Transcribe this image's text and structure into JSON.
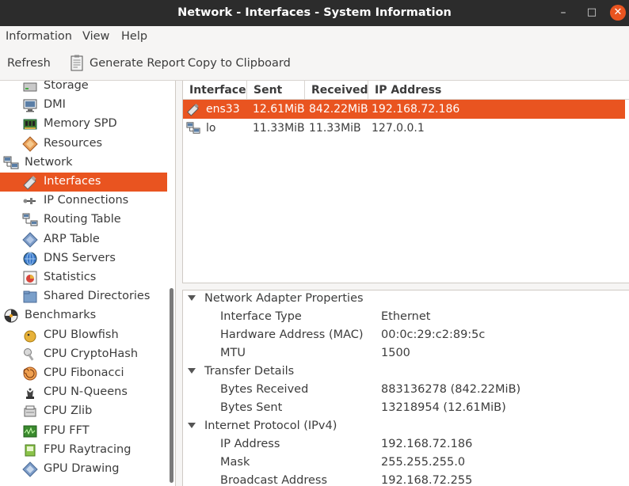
{
  "window": {
    "title": "Network - Interfaces - System Information",
    "minimize": "–",
    "maximize": "□",
    "close": "✕"
  },
  "menu": {
    "items": [
      "Information",
      "View",
      "Help"
    ]
  },
  "toolbar": {
    "refresh_label": "Refresh",
    "generate_report_label": "Generate Report",
    "copy_label": "Copy to Clipboard"
  },
  "sidebar": {
    "items": [
      {
        "label": "Storage",
        "icon": "storage-icon",
        "indent": 1
      },
      {
        "label": "DMI",
        "icon": "dmi-icon",
        "indent": 1
      },
      {
        "label": "Memory SPD",
        "icon": "memory-icon",
        "indent": 1
      },
      {
        "label": "Resources",
        "icon": "resources-icon",
        "indent": 1
      },
      {
        "label": "Network",
        "icon": "network-icon",
        "indent": 0
      },
      {
        "label": "Interfaces",
        "icon": "interface-icon",
        "indent": 1,
        "selected": true
      },
      {
        "label": "IP Connections",
        "icon": "ip-connections-icon",
        "indent": 1
      },
      {
        "label": "Routing Table",
        "icon": "routing-table-icon",
        "indent": 1
      },
      {
        "label": "ARP Table",
        "icon": "arp-table-icon",
        "indent": 1
      },
      {
        "label": "DNS Servers",
        "icon": "dns-servers-icon",
        "indent": 1
      },
      {
        "label": "Statistics",
        "icon": "statistics-icon",
        "indent": 1
      },
      {
        "label": "Shared Directories",
        "icon": "shared-directories-icon",
        "indent": 1
      },
      {
        "label": "Benchmarks",
        "icon": "benchmarks-icon",
        "indent": 0
      },
      {
        "label": "CPU Blowfish",
        "icon": "blowfish-icon",
        "indent": 1
      },
      {
        "label": "CPU CryptoHash",
        "icon": "cryptohash-icon",
        "indent": 1
      },
      {
        "label": "CPU Fibonacci",
        "icon": "fibonacci-icon",
        "indent": 1
      },
      {
        "label": "CPU N-Queens",
        "icon": "nqueens-icon",
        "indent": 1
      },
      {
        "label": "CPU Zlib",
        "icon": "zlib-icon",
        "indent": 1
      },
      {
        "label": "FPU FFT",
        "icon": "fft-icon",
        "indent": 1
      },
      {
        "label": "FPU Raytracing",
        "icon": "raytracing-icon",
        "indent": 1
      },
      {
        "label": "GPU Drawing",
        "icon": "gpu-drawing-icon",
        "indent": 1
      }
    ]
  },
  "table": {
    "columns": [
      "Interface",
      "Sent",
      "Received",
      "IP Address"
    ],
    "rows": [
      {
        "interface": "ens33",
        "sent": "12.61MiB",
        "received": "842.22MiB",
        "ip": "192.168.72.186",
        "selected": true
      },
      {
        "interface": "lo",
        "sent": "11.33MiB",
        "received": "11.33MiB",
        "ip": "127.0.0.1"
      }
    ]
  },
  "details": {
    "sections": [
      {
        "title": "Network Adapter Properties",
        "rows": [
          {
            "key": "Interface Type",
            "value": "Ethernet"
          },
          {
            "key": "Hardware Address (MAC)",
            "value": "00:0c:29:c2:89:5c"
          },
          {
            "key": "MTU",
            "value": "1500"
          }
        ]
      },
      {
        "title": "Transfer Details",
        "rows": [
          {
            "key": "Bytes Received",
            "value": "883136278 (842.22MiB)"
          },
          {
            "key": "Bytes Sent",
            "value": "13218954 (12.61MiB)"
          }
        ]
      },
      {
        "title": "Internet Protocol (IPv4)",
        "rows": [
          {
            "key": "IP Address",
            "value": "192.168.72.186"
          },
          {
            "key": "Mask",
            "value": "255.255.255.0"
          },
          {
            "key": "Broadcast Address",
            "value": "192.168.72.255"
          }
        ]
      }
    ]
  },
  "colors": {
    "accent": "#e95420",
    "titlebar": "#2c2c2c",
    "window_bg": "#f6f5f4"
  }
}
